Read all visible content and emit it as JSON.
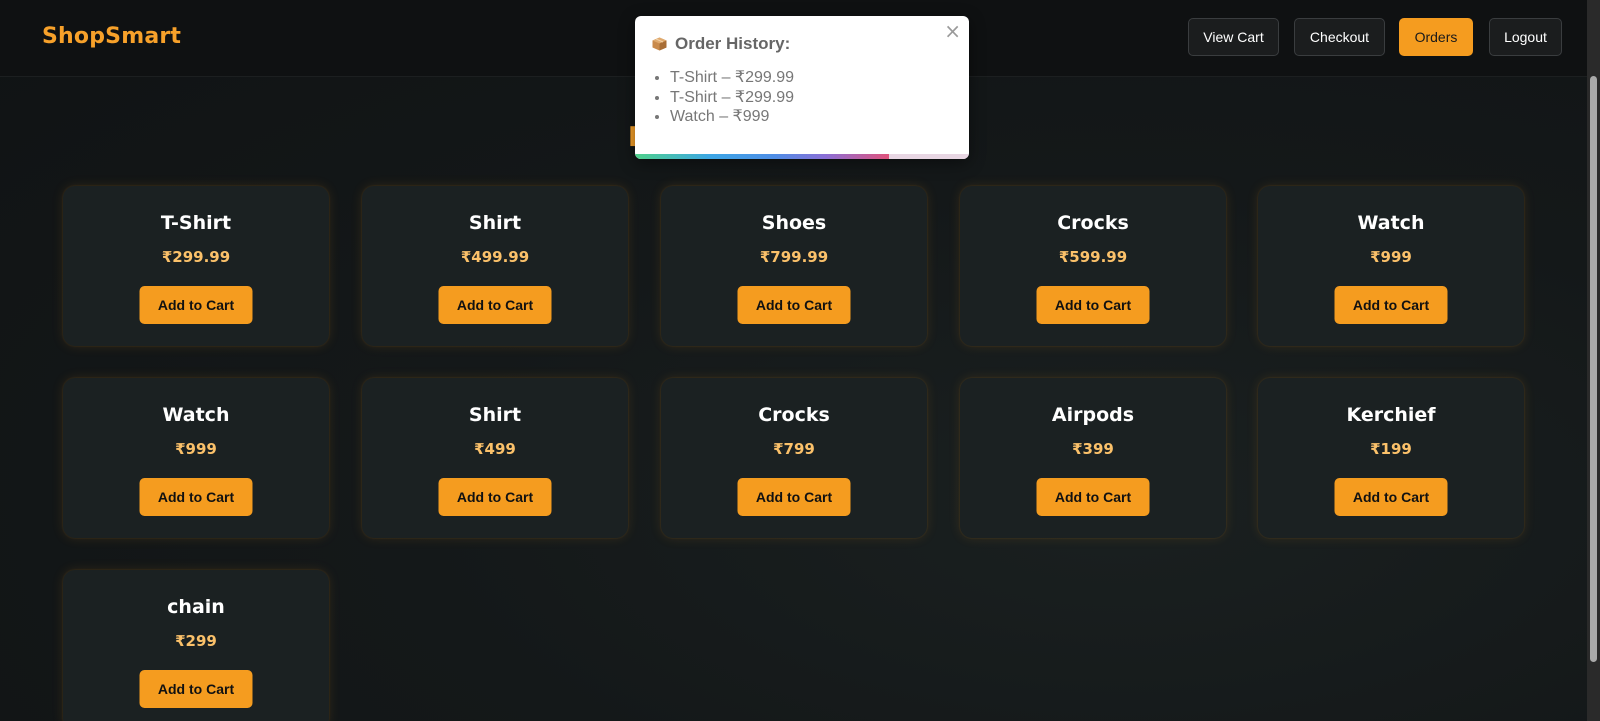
{
  "brand": "ShopSmart",
  "nav": {
    "view_cart": "View Cart",
    "checkout": "Checkout",
    "orders": "Orders",
    "logout": "Logout"
  },
  "modal": {
    "icon": "package-icon",
    "heading": "Order History:",
    "orders": [
      "T-Shirt – ₹299.99",
      "T-Shirt – ₹299.99",
      "Watch – ₹999"
    ],
    "close": "×",
    "progress_fraction": 0.76
  },
  "products": [
    {
      "name": "T-Shirt",
      "price": "₹299.99",
      "button": "Add to Cart"
    },
    {
      "name": "Shirt",
      "price": "₹499.99",
      "button": "Add to Cart"
    },
    {
      "name": "Shoes",
      "price": "₹799.99",
      "button": "Add to Cart"
    },
    {
      "name": "Crocks",
      "price": "₹599.99",
      "button": "Add to Cart"
    },
    {
      "name": "Watch",
      "price": "₹999",
      "button": "Add to Cart"
    },
    {
      "name": "Watch",
      "price": "₹999",
      "button": "Add to Cart"
    },
    {
      "name": "Shirt",
      "price": "₹499",
      "button": "Add to Cart"
    },
    {
      "name": "Crocks",
      "price": "₹799",
      "button": "Add to Cart"
    },
    {
      "name": "Airpods",
      "price": "₹399",
      "button": "Add to Cart"
    },
    {
      "name": "Kerchief",
      "price": "₹199",
      "button": "Add to Cart"
    },
    {
      "name": "chain",
      "price": "₹299",
      "button": "Add to Cart"
    }
  ],
  "colors": {
    "accent": "#f59c1f",
    "price": "#fbc16a",
    "card": "#1b2122",
    "background": "#121617"
  }
}
